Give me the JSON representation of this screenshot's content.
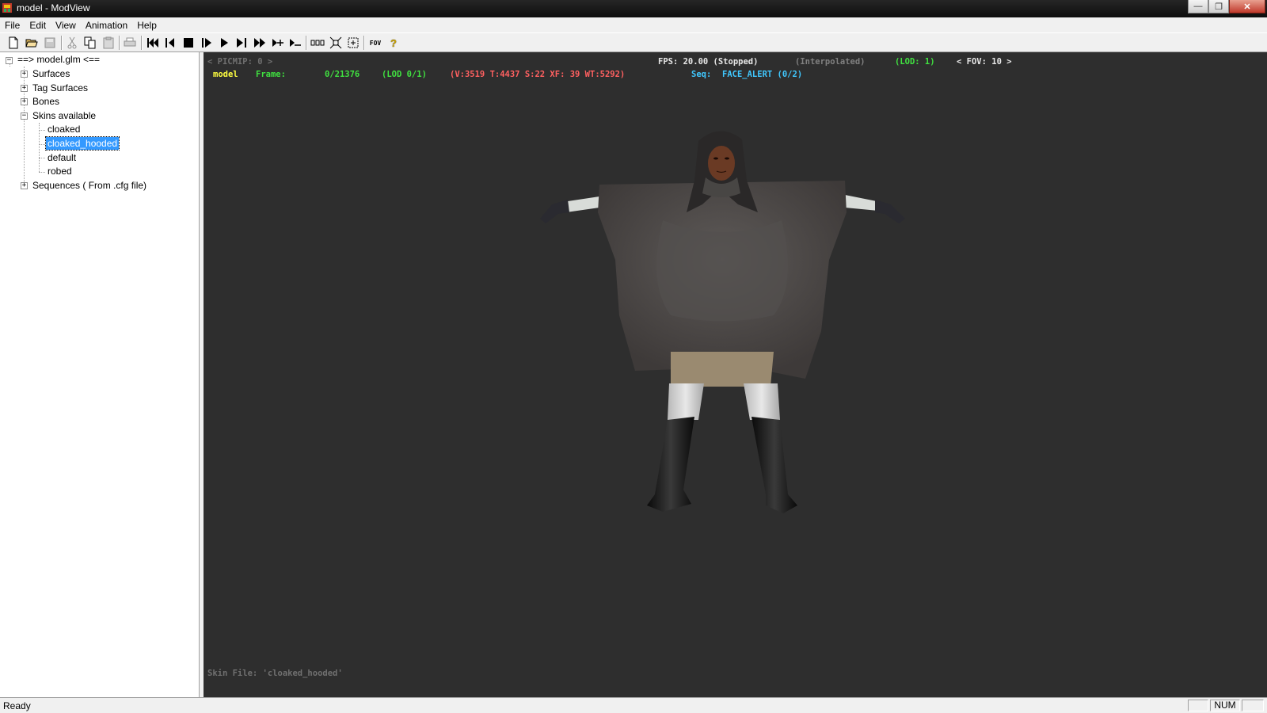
{
  "window": {
    "title": "model - ModView",
    "minimize_glyph": "—",
    "restore_glyph": "❐",
    "close_glyph": "✕"
  },
  "menu": {
    "items": [
      "File",
      "Edit",
      "View",
      "Animation",
      "Help"
    ]
  },
  "toolbar": {
    "icons": [
      "new-icon",
      "open-icon",
      "save-icon",
      "cut-icon",
      "copy-icon",
      "paste-icon",
      "print-icon",
      "rewind-icon",
      "step-back-icon",
      "stop-icon",
      "step-forward-icon",
      "play-icon",
      "next-frame-icon",
      "fast-forward-icon",
      "lod-up-icon",
      "lod-down-icon",
      "wireframe-icon",
      "zoom-fit-icon",
      "bbox-icon",
      "fov-icon",
      "help-icon"
    ],
    "fov_label": "FOV",
    "help_glyph": "?"
  },
  "tree": {
    "root": "==>  model.glm  <==",
    "nodes": {
      "surfaces": "Surfaces",
      "tag_surfaces": "Tag Surfaces",
      "bones": "Bones",
      "skins": "Skins available",
      "sequences": "Sequences ( From .cfg file)"
    },
    "skins": [
      "cloaked",
      "cloaked_hooded",
      "default",
      "robed"
    ],
    "expand_glyph": "+",
    "collapse_glyph": "−"
  },
  "viewport": {
    "picmip": "< PICMIP: 0 >",
    "fps": "FPS: 20.00 (Stopped)",
    "interpolated": "(Interpolated)",
    "lod": "(LOD: 1)",
    "fov": "< FOV: 10 >",
    "model_label": "model",
    "frame_label": "Frame:",
    "frame_value": "0/21376",
    "lod_count": "(LOD 0/1)",
    "stats": "(V:3519 T:4437 S:22 XF: 39 WT:5292)",
    "seq_label": "Seq:",
    "seq_value": "FACE_ALERT (0/2)",
    "skin_file": "Skin File: 'cloaked_hooded'",
    "colors": {
      "background": "#2e2e2e",
      "gray_text": "#808080",
      "white_text": "#e8e8e8",
      "green_text": "#40e040",
      "yellow_text": "#ffff40",
      "red_text": "#ff6060",
      "cyan_text": "#40c8ff"
    }
  },
  "status": {
    "text": "Ready",
    "num": "NUM"
  }
}
